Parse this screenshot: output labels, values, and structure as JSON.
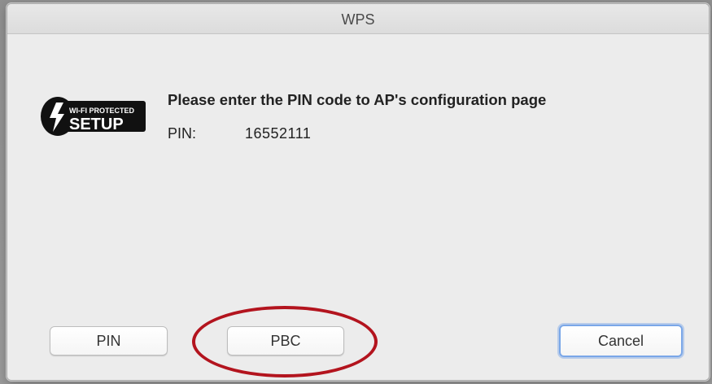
{
  "window": {
    "title": "WPS"
  },
  "logo": {
    "icon": "wifi-protected-setup-logo",
    "line1": "WI-FI PROTECTED",
    "line2": "SETUP"
  },
  "message": "Please enter the PIN code to AP's configuration page",
  "pin": {
    "label": "PIN:",
    "value": "16552111"
  },
  "buttons": {
    "pin": "PIN",
    "pbc": "PBC",
    "cancel": "Cancel"
  },
  "colors": {
    "highlight": "#b3141e",
    "default_button_focus": "#7aa7e8"
  }
}
